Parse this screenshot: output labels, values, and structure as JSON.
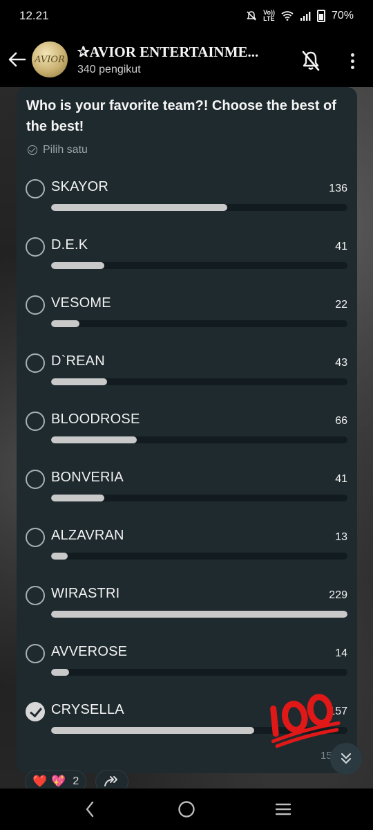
{
  "status_bar": {
    "time": "12.21",
    "network_label_top": "Vo))",
    "network_label_bottom": "LTE",
    "battery": "70%"
  },
  "header": {
    "avatar_text": "AVIOR",
    "channel_name": "✰AVIOR ENTERTAINME...",
    "followers": "340 pengikut"
  },
  "poll": {
    "question": "Who is your favorite team?! Choose the best of the best!",
    "hint": "Pilih satu",
    "max_votes": 229,
    "options": [
      {
        "label": "SKAYOR",
        "votes": 136,
        "count_text": "136",
        "selected": false
      },
      {
        "label": "D.E.K",
        "votes": 41,
        "count_text": "41",
        "selected": false
      },
      {
        "label": "VESOME",
        "votes": 22,
        "count_text": "22",
        "selected": false
      },
      {
        "label": "D`REAN",
        "votes": 43,
        "count_text": "43",
        "selected": false
      },
      {
        "label": "BLOODROSE",
        "votes": 66,
        "count_text": "66",
        "selected": false
      },
      {
        "label": "BONVERIA",
        "votes": 41,
        "count_text": "41",
        "selected": false
      },
      {
        "label": "ALZAVRAN",
        "votes": 13,
        "count_text": "13",
        "selected": false
      },
      {
        "label": "WIRASTRI",
        "votes": 229,
        "count_text": "229",
        "selected": false
      },
      {
        "label": "AVVEROSE",
        "votes": 14,
        "count_text": "14",
        "selected": false
      },
      {
        "label": "CRYSELLA",
        "votes": 157,
        "count_text": "157",
        "selected": true
      }
    ],
    "partial_count": "15"
  },
  "reactions": {
    "emojis": [
      "❤️",
      "💖"
    ],
    "count": "2"
  },
  "colors": {
    "card": "#1f2a2f",
    "bar_fill": "#c9c9c9",
    "bar_track": "#121b1f",
    "hundred_red": "#e01818"
  }
}
